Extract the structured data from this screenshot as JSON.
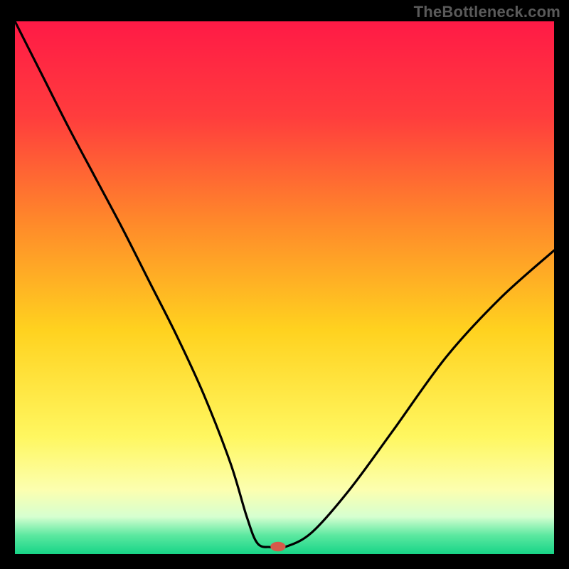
{
  "watermark": "TheBottleneck.com",
  "chart_data": {
    "type": "line",
    "title": "",
    "xlabel": "",
    "ylabel": "",
    "xlim": [
      0,
      100
    ],
    "ylim": [
      0,
      100
    ],
    "grid": false,
    "legend": false,
    "background_gradient": {
      "stops": [
        {
          "offset": 0.0,
          "color": "#ff1a46"
        },
        {
          "offset": 0.18,
          "color": "#ff3d3d"
        },
        {
          "offset": 0.38,
          "color": "#ff8a2a"
        },
        {
          "offset": 0.58,
          "color": "#ffd21f"
        },
        {
          "offset": 0.78,
          "color": "#fff760"
        },
        {
          "offset": 0.88,
          "color": "#fcffb0"
        },
        {
          "offset": 0.93,
          "color": "#d6ffd0"
        },
        {
          "offset": 0.965,
          "color": "#5be8a0"
        },
        {
          "offset": 1.0,
          "color": "#17d487"
        }
      ]
    },
    "series": [
      {
        "name": "bottleneck-curve",
        "x": [
          0.0,
          5.0,
          10.0,
          15.0,
          20.0,
          25.0,
          30.0,
          35.0,
          40.0,
          43.0,
          45.0,
          47.5,
          50.0,
          55.0,
          62.0,
          70.0,
          80.0,
          90.0,
          100.0
        ],
        "y": [
          100.0,
          90.0,
          80.0,
          70.5,
          61.0,
          51.0,
          41.0,
          30.0,
          17.0,
          7.0,
          2.0,
          1.3,
          1.3,
          4.0,
          12.0,
          23.0,
          37.0,
          48.0,
          57.0
        ]
      }
    ],
    "marker": {
      "name": "optimal-point",
      "x": 48.8,
      "y": 1.4,
      "color": "#d65a4a",
      "rx": 1.4,
      "ry": 0.9
    }
  }
}
